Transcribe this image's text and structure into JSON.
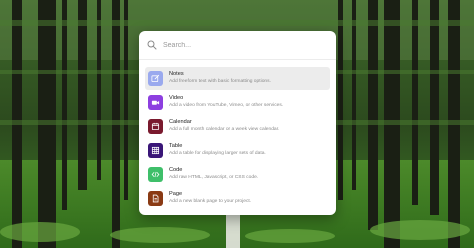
{
  "search": {
    "placeholder": "Search...",
    "value": ""
  },
  "items": [
    {
      "title": "Notes",
      "description": "Add freeform text with basic formatting options.",
      "icon": "pencil-square-icon",
      "color": "#9aa9ee",
      "selected": true
    },
    {
      "title": "Video",
      "description": "Add a video from YouTube, Vimeo, or other services.",
      "icon": "video-camera-icon",
      "color": "#8d3fe0"
    },
    {
      "title": "Calendar",
      "description": "Add a full month calendar or a week view calendar.",
      "icon": "calendar-icon",
      "color": "#7a1a2e"
    },
    {
      "title": "Table",
      "description": "Add a table for displaying larger sets of data.",
      "icon": "table-grid-icon",
      "color": "#3a1678"
    },
    {
      "title": "Code",
      "description": "Add raw HTML, Javascript, or CSS code.",
      "icon": "code-brackets-icon",
      "color": "#3fbf6a"
    },
    {
      "title": "Page",
      "description": "Add a new blank page to your project.",
      "icon": "document-icon",
      "color": "#8a3a14"
    }
  ]
}
